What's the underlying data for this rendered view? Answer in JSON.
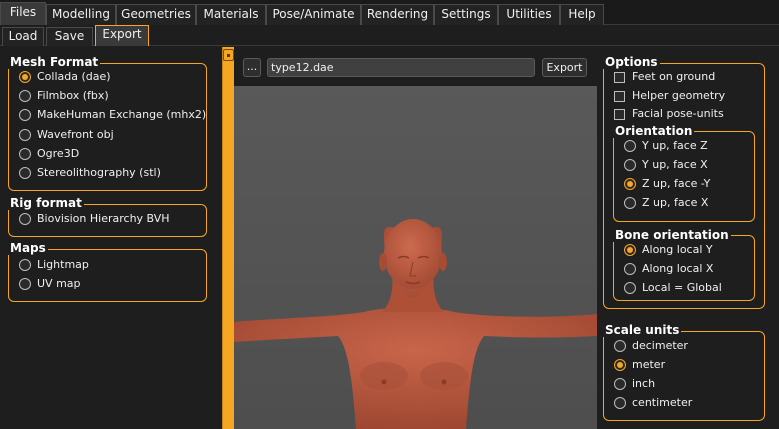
{
  "main_tabs": [
    "Files",
    "Modelling",
    "Geometries",
    "Materials",
    "Pose/Animate",
    "Rendering",
    "Settings",
    "Utilities",
    "Help"
  ],
  "sub_tabs": [
    "Load",
    "Save",
    "Export"
  ],
  "mesh_format": {
    "title": "Mesh Format",
    "options": [
      "Collada (dae)",
      "Filmbox (fbx)",
      "MakeHuman Exchange (mhx2)",
      "Wavefront obj",
      "Ogre3D",
      "Stereolithography (stl)"
    ],
    "selected": "Collada (dae)"
  },
  "rig_format": {
    "title": "Rig format",
    "options": [
      "Biovision Hierarchy BVH"
    ]
  },
  "maps": {
    "title": "Maps",
    "options": [
      "Lightmap",
      "UV map"
    ]
  },
  "toolbar": {
    "dots_label": "...",
    "filename": "type12.dae",
    "export_label": "Export"
  },
  "options": {
    "title": "Options",
    "checks": [
      "Feet on ground",
      "Helper geometry",
      "Facial pose-units"
    ]
  },
  "orientation": {
    "title": "Orientation",
    "options": [
      "Y up, face Z",
      "Y up, face X",
      "Z up, face -Y",
      "Z up, face X"
    ],
    "selected": "Z up, face -Y"
  },
  "bone_orientation": {
    "title": "Bone orientation",
    "options": [
      "Along local Y",
      "Along local X",
      "Local = Global"
    ],
    "selected": "Along local Y"
  },
  "scale_units": {
    "title": "Scale units",
    "options": [
      "decimeter",
      "meter",
      "inch",
      "centimeter"
    ],
    "selected": "meter"
  },
  "colors": {
    "accent": "#f5a623",
    "background": "#1e1e1e",
    "viewport": "#555555",
    "skin": "#b8573e"
  }
}
